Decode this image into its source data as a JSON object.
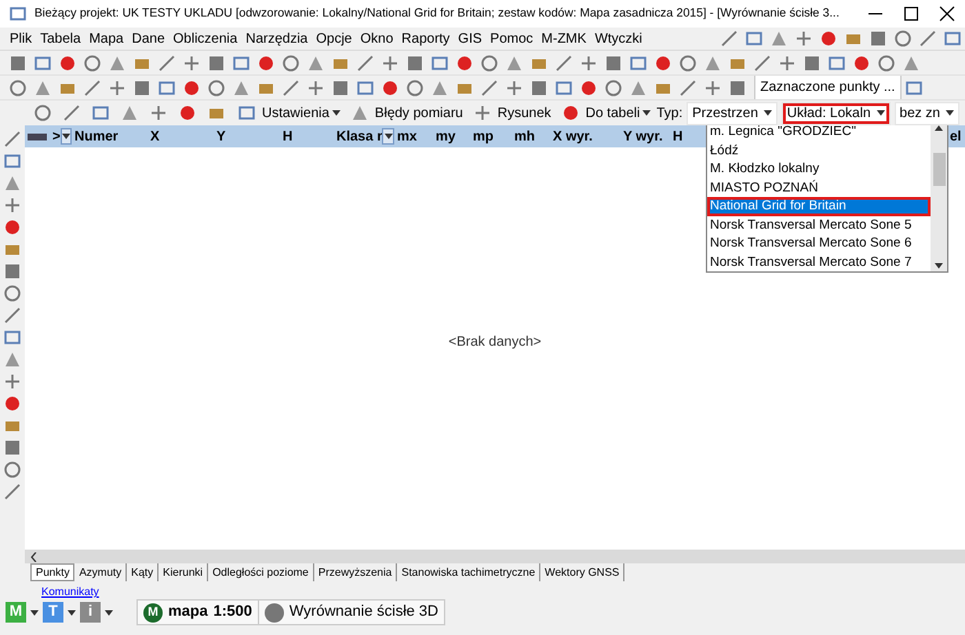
{
  "window": {
    "title": "Bieżący projekt: UK TESTY UKLADU [odwzorowanie: Lokalny/National Grid for Britain; zestaw kodów: Mapa zasadnicza 2015] - [Wyrównanie ścisłe 3..."
  },
  "menu": [
    "Plik",
    "Tabela",
    "Mapa",
    "Dane",
    "Obliczenia",
    "Narzędzia",
    "Opcje",
    "Okno",
    "Raporty",
    "GIS",
    "Pomoc",
    "M-ZMK",
    "Wtyczki"
  ],
  "toolbar_right_button": "Zaznaczone punkty ...",
  "toolbar": [
    {
      "kind": "button",
      "label": "Ustawienia",
      "caret": true
    },
    {
      "kind": "button",
      "label": "Błędy pomiaru",
      "caret": false
    },
    {
      "kind": "button",
      "label": "Rysunek",
      "caret": false
    },
    {
      "kind": "button",
      "label": "Do tabeli",
      "caret": true
    },
    {
      "kind": "label",
      "label": "Typ:"
    },
    {
      "kind": "combo",
      "label": "Przestrzen",
      "highlighted": false
    },
    {
      "kind": "combo",
      "label": "Układ: Lokaln",
      "highlighted": true
    },
    {
      "kind": "combo",
      "label": "bez zn",
      "highlighted": false
    }
  ],
  "table": {
    "columns": [
      {
        "label": ">",
        "filter": true
      },
      {
        "label": "Numer",
        "filter": false
      },
      {
        "label": "X",
        "filter": false
      },
      {
        "label": "Y",
        "filter": false
      },
      {
        "label": "H",
        "filter": false
      },
      {
        "label": "Klasa r",
        "filter": true
      },
      {
        "label": "mx",
        "filter": false
      },
      {
        "label": "my",
        "filter": false
      },
      {
        "label": "mp",
        "filter": false
      },
      {
        "label": "mh",
        "filter": false
      },
      {
        "label": "X wyr.",
        "filter": false
      },
      {
        "label": "Y wyr.",
        "filter": false
      },
      {
        "label": "H",
        "filter": false
      },
      {
        "label": "el"
      }
    ],
    "empty_message": "<Brak danych>"
  },
  "dropdown": {
    "items": [
      {
        "label": "m. Legnica \"GRODZIEC\"",
        "selected": false
      },
      {
        "label": "Łódź",
        "selected": false
      },
      {
        "label": "M. Kłodzko lokalny",
        "selected": false
      },
      {
        "label": "MIASTO POZNAŃ",
        "selected": false
      },
      {
        "label": "National Grid for Britain",
        "selected": true
      },
      {
        "label": "Norsk Transversal Mercato Sone 5",
        "selected": false
      },
      {
        "label": "Norsk Transversal Mercato Sone 6",
        "selected": false
      },
      {
        "label": "Norsk Transversal Mercato Sone 7",
        "selected": false
      }
    ]
  },
  "tabs": [
    {
      "label": "Punkty",
      "selected": true
    },
    {
      "label": "Azymuty",
      "selected": false
    },
    {
      "label": "Kąty",
      "selected": false
    },
    {
      "label": "Kierunki",
      "selected": false
    },
    {
      "label": "Odległości poziome",
      "selected": false
    },
    {
      "label": "Przewyższenia",
      "selected": false
    },
    {
      "label": "Stanowiska tachimetryczne",
      "selected": false
    },
    {
      "label": "Wektory GNSS",
      "selected": false
    }
  ],
  "messages_link": "Komunikaty",
  "status_bar": {
    "mode_buttons": [
      {
        "label": "M",
        "color": "#3cb043"
      },
      {
        "label": "T",
        "color": "#4a90e2"
      },
      {
        "label": "i",
        "color": "#8a8a8a"
      }
    ],
    "map_badge": "M",
    "map_name": "mapa",
    "scale": "1:500",
    "window_name": "Wyrównanie ścisłe 3D"
  }
}
